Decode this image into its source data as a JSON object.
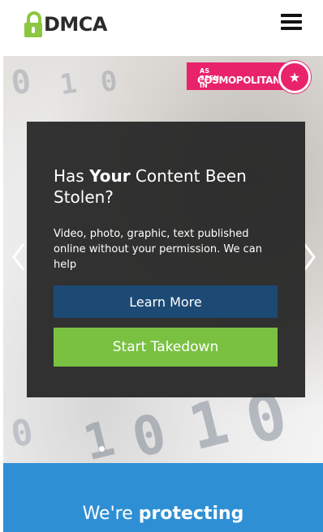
{
  "header": {
    "logo_text": "DMCA",
    "menu_icon": "hamburger-menu-icon"
  },
  "badge": {
    "line1": "AS SEEN IN",
    "line2": "COSMOPOLITAN",
    "icon": "star-icon",
    "color": "#e8236b"
  },
  "hero": {
    "title_prefix": "Has ",
    "title_bold": "Your",
    "title_suffix": " Content Been Stolen?",
    "description": "Video, photo, graphic, text published online without your permission. We can help",
    "learn_more_label": "Learn More",
    "start_takedown_label": "Start Takedown",
    "prev_icon": "chevron-left-icon",
    "next_icon": "chevron-right-icon"
  },
  "band": {
    "text_prefix": "We're ",
    "text_bold": "protecting"
  },
  "colors": {
    "accent_green": "#7ac142",
    "navy": "#1c4a74",
    "band_blue": "#2e8fd5",
    "logo_green": "#8cc63f"
  }
}
